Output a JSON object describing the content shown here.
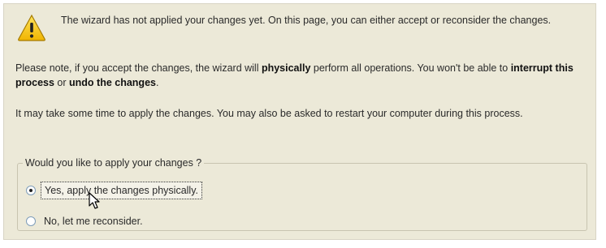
{
  "warning": {
    "icon": "warning-icon",
    "text": "The wizard has not applied your changes yet. On this page, you can either accept or reconsider the changes."
  },
  "note": {
    "prefix": "Please note, if you accept the changes, the wizard will ",
    "bold1": "physically",
    "middle": " perform all operations. You won't be able to ",
    "bold2": "interrupt this process",
    "connector": " or ",
    "bold3": "undo the changes",
    "suffix": "."
  },
  "time_note": "It may take some time to apply the changes. You may also be asked to restart your computer during this process.",
  "apply_group": {
    "legend": "Would you like to apply your changes ?",
    "options": [
      {
        "label": "Yes, apply the changes physically.",
        "selected": true
      },
      {
        "label": "No, let me reconsider.",
        "selected": false
      }
    ]
  },
  "colors": {
    "panel_bg": "#ece9d8",
    "warning_yellow": "#f5c400"
  }
}
